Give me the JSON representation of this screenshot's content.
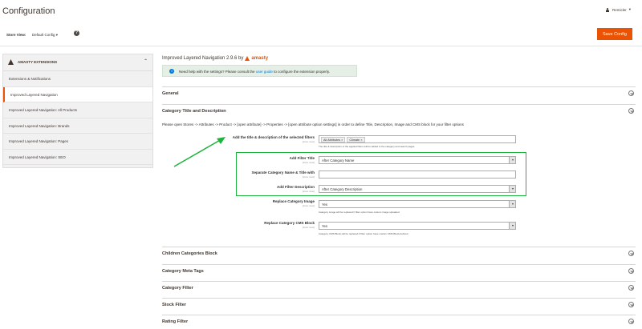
{
  "header": {
    "title": "Configuration",
    "user": "Remicler"
  },
  "toolbar": {
    "scope_label": "Store View:",
    "scope_value": "Default Config",
    "help_glyph": "?",
    "save_label": "Save Config"
  },
  "sidebar": {
    "tab_title": "AMASTY EXTENSIONS",
    "items": [
      {
        "label": "Extensions & Notifications",
        "active": false
      },
      {
        "label": "Improved Layered Navigation",
        "active": true
      },
      {
        "label": "Improved Layered Navigation: All Products",
        "active": false
      },
      {
        "label": "Improved Layered Navigation: Brands",
        "active": false
      },
      {
        "label": "Improved Layered Navigation: Pages",
        "active": false
      },
      {
        "label": "Improved Layered Navigation: SEO",
        "active": false
      }
    ]
  },
  "extension": {
    "title": "Improved Layered Navigation 2.9.6 by",
    "brand": "amasty",
    "notice_prefix": "Need help with the settings? Please consult the",
    "notice_link": "user guide",
    "notice_suffix": "to configure the extension properly."
  },
  "sections": {
    "general": "General",
    "category_title": "Category Title and Description",
    "children": "Children Categories Block",
    "meta": "Category Meta Tags",
    "filter": "Category Filter",
    "stock": "Stock Filter",
    "rating": "Rating Filter"
  },
  "category_desc": "Please open Stores -> Attributes -> Product -> [open attribute] -> Properties -> [open attribute option settings] in order to define Title, Description, Image and CMS block for your filter options",
  "fields": {
    "selected_filters": {
      "label": "Add the title & description of the selected filters",
      "scope": "[store view]",
      "chips": [
        "All Attributes ×",
        "Climate ×"
      ],
      "hint": "The title & description of the applied filters will be added to the category and search pages"
    },
    "filter_title": {
      "label": "Add Filter Title",
      "scope": "[store view]",
      "value": "After Category Name"
    },
    "separate": {
      "label": "Separate Category Name & Title with",
      "scope": "[store view]",
      "value": ""
    },
    "filter_desc": {
      "label": "Add Filter Description",
      "scope": "[store view]",
      "value": "After Category Description"
    },
    "replace_image": {
      "label": "Replace Category Image",
      "scope": "[store view]",
      "value": "Yes",
      "hint": "Category image will be replaced if filter option have custom image uploaded"
    },
    "replace_cms": {
      "label": "Replace Category CMS Block",
      "scope": "[store view]",
      "value": "Yes",
      "hint": "Category CMS Block will be replaced if filter option have custom CMS Block defined"
    }
  },
  "colors": {
    "accent": "#eb5202",
    "highlight": "#1db33c",
    "notice_bg": "#e5efe5"
  }
}
